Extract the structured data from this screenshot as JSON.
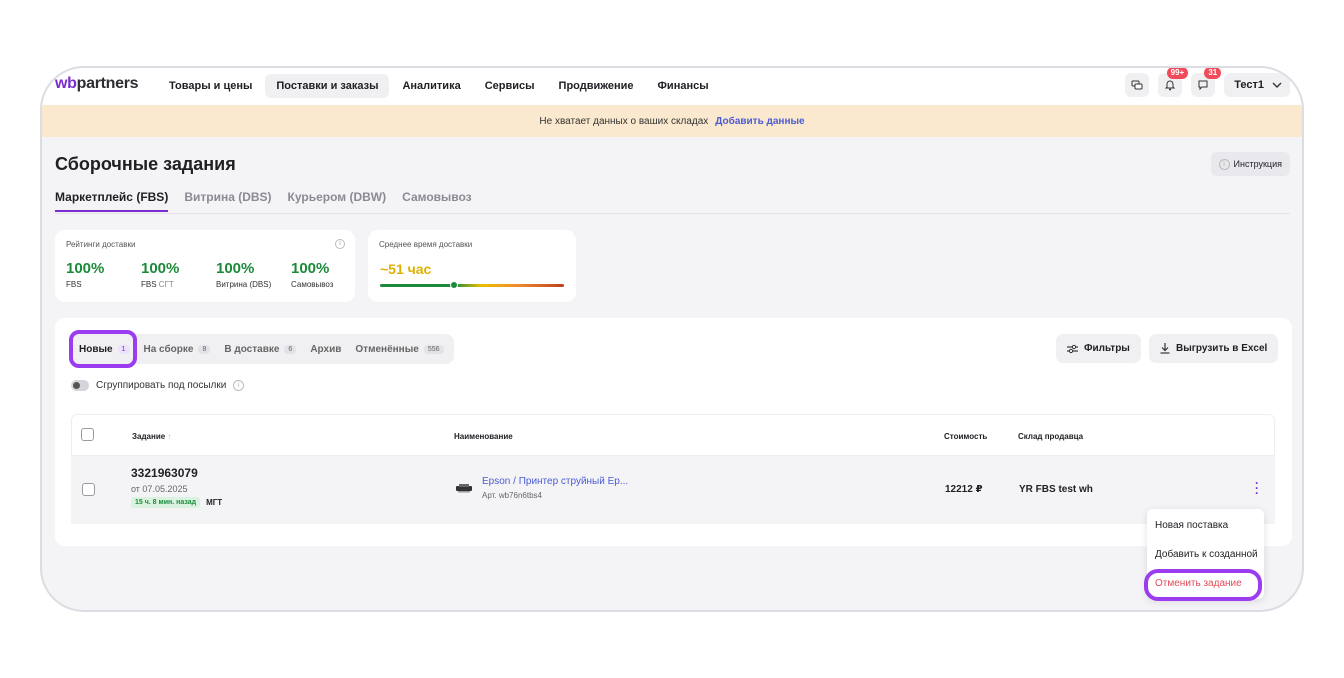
{
  "header": {
    "logo_prefix": "wb",
    "logo_suffix": "partners",
    "menu": [
      "Товары и цены",
      "Поставки и заказы",
      "Аналитика",
      "Сервисы",
      "Продвижение",
      "Финансы"
    ],
    "notifications_badge": "99+",
    "messages_badge": "31",
    "user": "Тест1"
  },
  "banner": {
    "text": "Не хватает данных о ваших складах",
    "link": "Добавить данные"
  },
  "page": {
    "title": "Сборочные задания",
    "instruction_button": "Инструкция"
  },
  "main_tabs": [
    "Маркетплейс (FBS)",
    "Витрина (DBS)",
    "Курьером (DBW)",
    "Самовывоз"
  ],
  "ratings": {
    "label": "Рейтинги доставки",
    "items": [
      {
        "value": "100%",
        "label": "FBS",
        "suffix": ""
      },
      {
        "value": "100%",
        "label": "FBS",
        "suffix": "СГТ"
      },
      {
        "value": "100%",
        "label": "Витрина (DBS)",
        "suffix": ""
      },
      {
        "value": "100%",
        "label": "Самовывоз",
        "suffix": ""
      }
    ]
  },
  "delivery_time": {
    "label": "Среднее время доставки",
    "value": "~51 час"
  },
  "subtabs": [
    {
      "label": "Новые",
      "count": "1"
    },
    {
      "label": "На сборке",
      "count": "8"
    },
    {
      "label": "В доставке",
      "count": "6"
    },
    {
      "label": "Архив",
      "count": ""
    },
    {
      "label": "Отменённые",
      "count": "556"
    }
  ],
  "buttons": {
    "filters": "Фильтры",
    "export": "Выгрузить в Excel"
  },
  "group_toggle_label": "Сгруппировать под посылки",
  "table": {
    "columns": [
      "Задание",
      "Наименование",
      "Стоимость",
      "Склад продавца"
    ],
    "rows": [
      {
        "order_no": "3321963079",
        "date": "от 07.05.2025",
        "time_tag": "15 ч. 8 мин. назад",
        "type_tag": "МГТ",
        "product_name": "Epson / Принтер струйный Ep...",
        "article": "Арт. wb76n6tbs4",
        "price": "12212 ₽",
        "warehouse": "YR FBS test wh"
      }
    ]
  },
  "context_menu": {
    "items": [
      "Новая поставка",
      "Добавить к созданной",
      "Отменить задание"
    ]
  },
  "colors": {
    "accent": "#7a2ccf",
    "highlight": "#9b3cf0",
    "banner": "#fbe9cf",
    "success": "#1c8a3a",
    "danger": "#e24a5a",
    "link": "#4a5bd4"
  }
}
